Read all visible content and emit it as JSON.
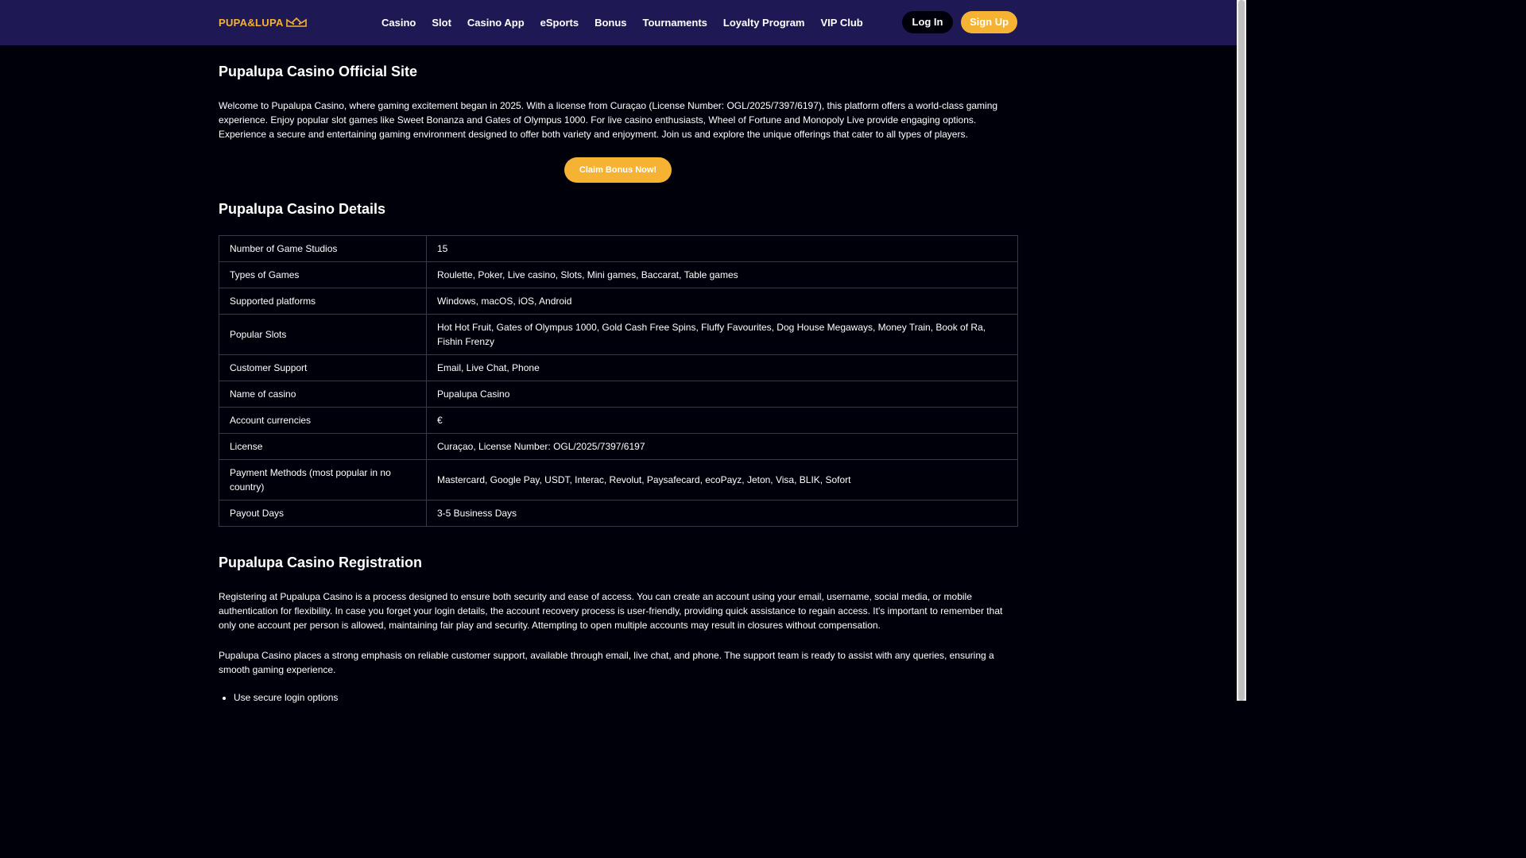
{
  "header": {
    "logo_text": "PUPA&LUPA",
    "nav": [
      "Casino",
      "Slot",
      "Casino App",
      "eSports",
      "Bonus",
      "Tournaments",
      "Loyalty Program",
      "VIP Club"
    ],
    "login_label": "Log In",
    "signup_label": "Sign Up"
  },
  "main": {
    "title": "Pupalupa Casino Official Site",
    "intro": "Welcome to Pupalupa Casino, where gaming excitement began in 2025. With a license from Curaçao (License Number: OGL/2025/7397/6197), this platform offers a world-class gaming experience. Enjoy popular slot games like Sweet Bonanza and Gates of Olympus 1000. For live casino enthusiasts, Wheel of Fortune and Monopoly Live provide engaging options. Experience a secure and entertaining gaming environment designed to offer both variety and enjoyment. Join us and explore the unique offerings that cater to all types of players.",
    "claim_label": "Claim Bonus Now!",
    "details_title": "Pupalupa Casino Details",
    "details": [
      {
        "key": "Number of Game Studios",
        "value": "15"
      },
      {
        "key": "Types of Games",
        "value": "Roulette, Poker, Live casino, Slots, Mini games, Baccarat, Table games"
      },
      {
        "key": "Supported platforms",
        "value": "Windows, macOS, iOS, Android"
      },
      {
        "key": "Popular Slots",
        "value": "Hot Hot Fruit, Gates of Olympus 1000, Gold Cash Free Spins, Fluffy Favourites, Dog House Megaways, Money Train, Book of Ra, Fishin Frenzy"
      },
      {
        "key": "Customer Support",
        "value": "Email, Live Chat, Phone"
      },
      {
        "key": "Name of casino",
        "value": "Pupalupa Casino"
      },
      {
        "key": "Account currencies",
        "value": "€"
      },
      {
        "key": "License",
        "value": "Curaçao, License Number: OGL/2025/7397/6197"
      },
      {
        "key": "Payment Methods (most popular in no country)",
        "value": "Mastercard, Google Pay, USDT, Interac, Revolut, Paysafecard, ecoPayz, Jeton, Visa, BLIK, Sofort"
      },
      {
        "key": "Payout Days",
        "value": "3-5 Business Days"
      }
    ],
    "registration_title": "Pupalupa Casino Registration",
    "registration_p1": "Registering at Pupalupa Casino is a process designed to ensure both security and ease of access. You can create an account using your email, username, social media, or mobile authentication for flexibility. In case you forget your login details, the account recovery process is user-friendly, providing quick assistance to regain access. It's important to remember that only one account per person is allowed, maintaining fair play and security. Attempting to open multiple accounts may result in closures without compensation.",
    "registration_p2": "Pupalupa Casino places a strong emphasis on reliable customer support, available through email, live chat, and phone. The support team is ready to assist with any queries, ensuring a smooth gaming experience.",
    "list_items": [
      "Use secure login options"
    ]
  },
  "colors": {
    "header_bg": "#1e1954",
    "accent": "#f6b233",
    "page_bg": "#00000a"
  }
}
